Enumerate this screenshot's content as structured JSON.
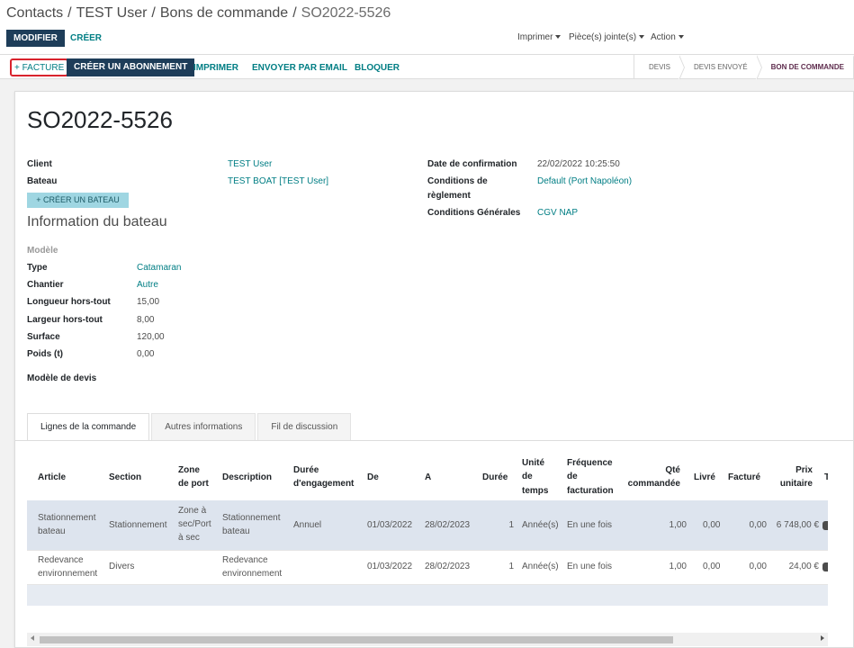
{
  "breadcrumb": {
    "items": [
      "Contacts",
      "TEST User",
      "Bons de commande"
    ],
    "current": "SO2022-5526",
    "sep": "/"
  },
  "actions": {
    "edit": "MODIFIER",
    "create": "CRÉER",
    "print": "Imprimer",
    "attachments": "Pièce(s) jointe(s)",
    "action": "Action"
  },
  "statusbar": {
    "invoice": "+ FACTURE",
    "subscription": "CRÉER UN ABONNEMENT",
    "print": "IMPRIMER",
    "email": "ENVOYER PAR EMAIL",
    "block": "BLOQUER",
    "steps": [
      "DEVIS",
      "DEVIS ENVOYÉ",
      "BON DE COMMANDE"
    ],
    "active_step": "BON DE COMMANDE"
  },
  "form": {
    "title": "SO2022-5526",
    "client_label": "Client",
    "client_value": "TEST User",
    "boat_label": "Bateau",
    "boat_value": "TEST BOAT [TEST User]",
    "create_boat": "+ CRÉER UN BATEAU",
    "confirm_label": "Date de confirmation",
    "confirm_value": "22/02/2022 10:25:50",
    "payment_label_1": "Conditions de",
    "payment_label_2": "règlement",
    "payment_value": "Default (Port Napoléon)",
    "cgv_label": "Conditions Générales",
    "cgv_value": "CGV NAP",
    "boat_info_title": "Information du bateau",
    "model_label": "Modèle",
    "type_label": "Type",
    "type_value": "Catamaran",
    "yard_label": "Chantier",
    "yard_value": "Autre",
    "length_label": "Longueur hors-tout",
    "length_value": "15,00",
    "width_label": "Largeur hors-tout",
    "width_value": "8,00",
    "surface_label": "Surface",
    "surface_value": "120,00",
    "weight_label": "Poids (t)",
    "weight_value": "0,00",
    "quote_model_label": "Modèle de devis"
  },
  "tabs": [
    "Lignes de la commande",
    "Autres informations",
    "Fil de discussion"
  ],
  "table": {
    "headers": {
      "article": "Article",
      "section": "Section",
      "zone_1": "Zone",
      "zone_2": "de port",
      "description": "Description",
      "duree_eng_1": "Durée",
      "duree_eng_2": "d'engagement",
      "de": "De",
      "a": "A",
      "duree": "Durée",
      "unite_1": "Unité",
      "unite_2": "de",
      "unite_3": "temps",
      "freq_1": "Fréquence",
      "freq_2": "de",
      "freq_3": "facturation",
      "qte_1": "Qté",
      "qte_2": "commandée",
      "livre": "Livré",
      "facture": "Facturé",
      "prix_1": "Prix",
      "prix_2": "unitaire",
      "t": "T"
    },
    "rows": [
      {
        "article_1": "Stationnement",
        "article_2": "bateau",
        "section": "Stationnement",
        "zone_1": "Zone à",
        "zone_2": "sec/Port",
        "zone_3": "à sec",
        "desc_1": "Stationnement",
        "desc_2": "bateau",
        "engagement": "Annuel",
        "de": "01/03/2022",
        "a": "28/02/2023",
        "duree": "1",
        "unite": "Année(s)",
        "freq": "En une fois",
        "qte": "1,00",
        "livre": "0,00",
        "facture": "0,00",
        "prix": "6 748,00 €"
      },
      {
        "article_1": "Redevance",
        "article_2": "environnement",
        "section": "Divers",
        "desc_1": "Redevance",
        "desc_2": "environnement",
        "de": "01/03/2022",
        "a": "28/02/2023",
        "duree": "1",
        "unite": "Année(s)",
        "freq": "En une fois",
        "qte": "1,00",
        "livre": "0,00",
        "facture": "0,00",
        "prix": "24,00 €"
      }
    ]
  },
  "colors": {
    "primary": "#1e3d59",
    "link": "#017e84",
    "highlight_row": "#dde4ee",
    "empty_row": "#e6ebf2",
    "active_step": "#5f2d4e"
  }
}
